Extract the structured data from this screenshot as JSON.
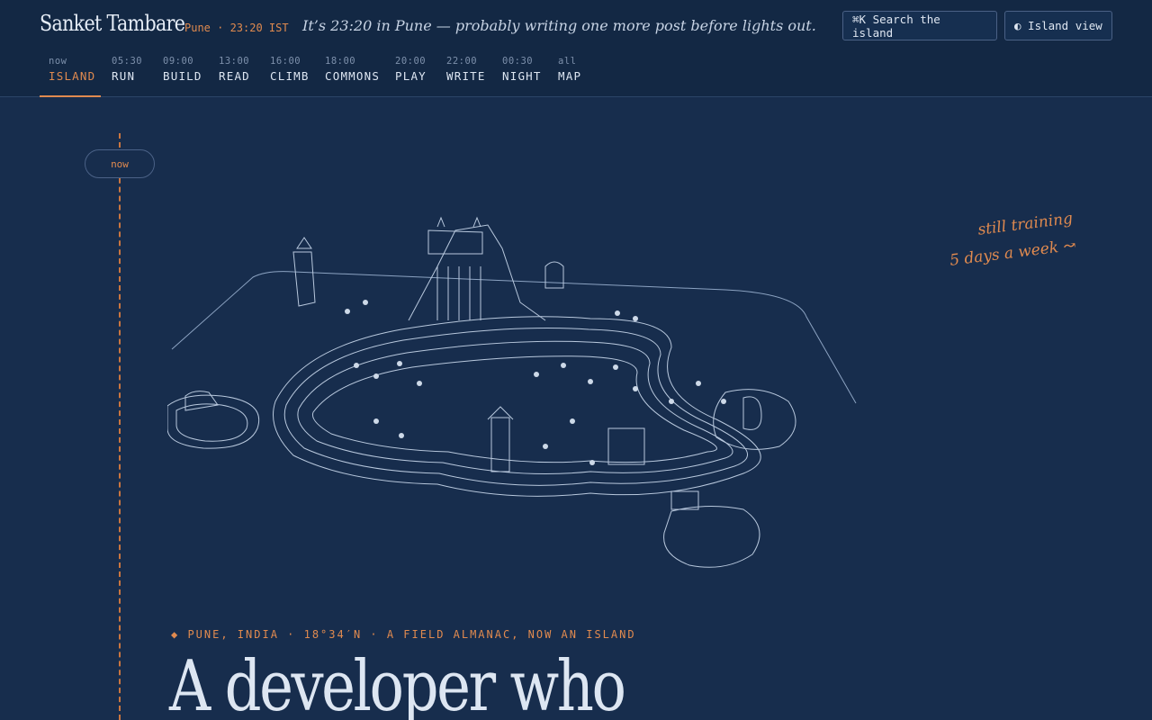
{
  "header": {
    "brand": "Sanket Tambare",
    "clock": "Pune · 23:20 IST",
    "tagline": "It’s 23:20 in Pune — probably writing one more post before lights out.",
    "search_label": "⌘K Search the island",
    "view_label": "◐ Island view"
  },
  "nav": {
    "tabs": [
      {
        "time": "now",
        "label": "ISLAND",
        "active": true
      },
      {
        "time": "05:30",
        "label": "RUN"
      },
      {
        "time": "09:00",
        "label": "BUILD"
      },
      {
        "time": "13:00",
        "label": "READ"
      },
      {
        "time": "16:00",
        "label": "CLIMB"
      },
      {
        "time": "18:00",
        "label": "COMMONS"
      },
      {
        "time": "20:00",
        "label": "PLAY"
      },
      {
        "time": "22:00",
        "label": "WRITE"
      },
      {
        "time": "00:30",
        "label": "NIGHT"
      },
      {
        "time": "all",
        "label": "MAP"
      }
    ]
  },
  "timeline": {
    "now_label": "now"
  },
  "note": {
    "line1": "still training",
    "line2": "5 days a week ↝"
  },
  "hero": {
    "kicker": "◆ PUNE, INDIA · 18°34′N · A FIELD ALMANAC, NOW AN ISLAND",
    "headline": "A developer who"
  },
  "colors": {
    "background": "#172d4d",
    "topbar": "#132844",
    "accent": "#e08a4f",
    "ink": "#dde6f2"
  }
}
